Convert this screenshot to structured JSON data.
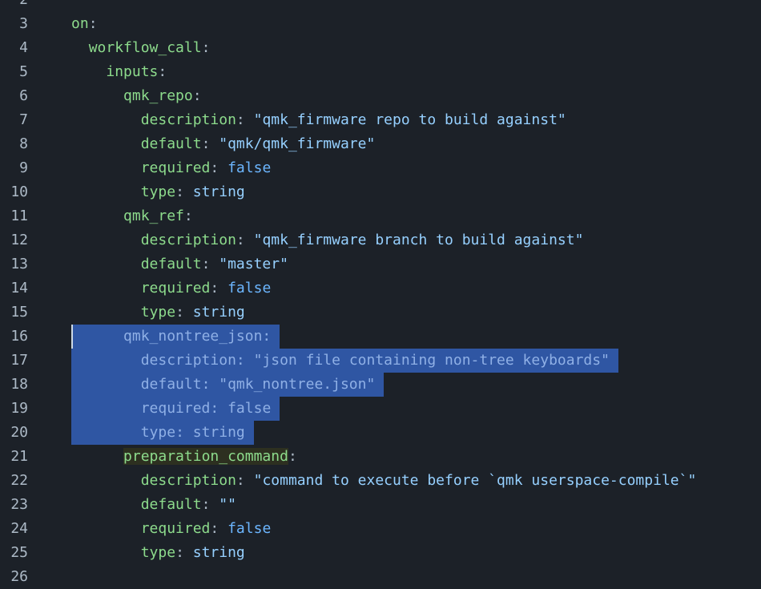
{
  "editor": {
    "theme": {
      "background": "#1c2128",
      "line_number": "#adbac7",
      "key": "#8ddb8c",
      "string": "#96d0ff",
      "boolean": "#6cb6ff",
      "selection": "#2f56a3",
      "bracket_match": "#2d3020"
    },
    "selected_lines": [
      16,
      17,
      18,
      19,
      20
    ],
    "cursor_line": 16,
    "lines": [
      {
        "n": "2",
        "indent": 0,
        "tokens": []
      },
      {
        "n": "3",
        "indent": 0,
        "tokens": [
          {
            "t": "on",
            "c": "key"
          },
          {
            "t": ":",
            "c": "punct"
          }
        ]
      },
      {
        "n": "4",
        "indent": 1,
        "tokens": [
          {
            "t": "workflow_call",
            "c": "key"
          },
          {
            "t": ":",
            "c": "punct"
          }
        ]
      },
      {
        "n": "5",
        "indent": 2,
        "tokens": [
          {
            "t": "inputs",
            "c": "key"
          },
          {
            "t": ":",
            "c": "punct"
          }
        ]
      },
      {
        "n": "6",
        "indent": 3,
        "tokens": [
          {
            "t": "qmk_repo",
            "c": "key"
          },
          {
            "t": ":",
            "c": "punct"
          }
        ]
      },
      {
        "n": "7",
        "indent": 4,
        "tokens": [
          {
            "t": "description",
            "c": "key"
          },
          {
            "t": ": ",
            "c": "punct"
          },
          {
            "t": "\"qmk_firmware repo to build against\"",
            "c": "str"
          }
        ]
      },
      {
        "n": "8",
        "indent": 4,
        "tokens": [
          {
            "t": "default",
            "c": "key"
          },
          {
            "t": ": ",
            "c": "punct"
          },
          {
            "t": "\"qmk/qmk_firmware\"",
            "c": "str"
          }
        ]
      },
      {
        "n": "9",
        "indent": 4,
        "tokens": [
          {
            "t": "required",
            "c": "key"
          },
          {
            "t": ": ",
            "c": "punct"
          },
          {
            "t": "false",
            "c": "bool"
          }
        ]
      },
      {
        "n": "10",
        "indent": 4,
        "tokens": [
          {
            "t": "type",
            "c": "key"
          },
          {
            "t": ": ",
            "c": "punct"
          },
          {
            "t": "string",
            "c": "plain"
          }
        ]
      },
      {
        "n": "11",
        "indent": 3,
        "tokens": [
          {
            "t": "qmk_ref",
            "c": "key"
          },
          {
            "t": ":",
            "c": "punct"
          }
        ]
      },
      {
        "n": "12",
        "indent": 4,
        "tokens": [
          {
            "t": "description",
            "c": "key"
          },
          {
            "t": ": ",
            "c": "punct"
          },
          {
            "t": "\"qmk_firmware branch to build against\"",
            "c": "str"
          }
        ]
      },
      {
        "n": "13",
        "indent": 4,
        "tokens": [
          {
            "t": "default",
            "c": "key"
          },
          {
            "t": ": ",
            "c": "punct"
          },
          {
            "t": "\"master\"",
            "c": "str"
          }
        ]
      },
      {
        "n": "14",
        "indent": 4,
        "tokens": [
          {
            "t": "required",
            "c": "key"
          },
          {
            "t": ": ",
            "c": "punct"
          },
          {
            "t": "false",
            "c": "bool"
          }
        ]
      },
      {
        "n": "15",
        "indent": 4,
        "tokens": [
          {
            "t": "type",
            "c": "key"
          },
          {
            "t": ": ",
            "c": "punct"
          },
          {
            "t": "string",
            "c": "plain"
          }
        ]
      },
      {
        "n": "16",
        "indent": 3,
        "tokens": [
          {
            "t": "qmk_nontree_json",
            "c": "key"
          },
          {
            "t": ":",
            "c": "punct"
          }
        ]
      },
      {
        "n": "17",
        "indent": 4,
        "tokens": [
          {
            "t": "description",
            "c": "key"
          },
          {
            "t": ": ",
            "c": "punct"
          },
          {
            "t": "\"json file containing non-tree keyboards\"",
            "c": "str"
          }
        ]
      },
      {
        "n": "18",
        "indent": 4,
        "tokens": [
          {
            "t": "default",
            "c": "key"
          },
          {
            "t": ": ",
            "c": "punct"
          },
          {
            "t": "\"qmk_nontree.json\"",
            "c": "str"
          }
        ]
      },
      {
        "n": "19",
        "indent": 4,
        "tokens": [
          {
            "t": "required",
            "c": "key"
          },
          {
            "t": ": ",
            "c": "punct"
          },
          {
            "t": "false",
            "c": "bool"
          }
        ]
      },
      {
        "n": "20",
        "indent": 4,
        "tokens": [
          {
            "t": "type",
            "c": "key"
          },
          {
            "t": ": ",
            "c": "punct"
          },
          {
            "t": "string",
            "c": "plain"
          }
        ]
      },
      {
        "n": "21",
        "indent": 3,
        "tokens": [
          {
            "t": "preparation_command",
            "c": "key",
            "match": true
          },
          {
            "t": ":",
            "c": "punct"
          }
        ]
      },
      {
        "n": "22",
        "indent": 4,
        "tokens": [
          {
            "t": "description",
            "c": "key"
          },
          {
            "t": ": ",
            "c": "punct"
          },
          {
            "t": "\"command to execute before `qmk userspace-compile`\"",
            "c": "str"
          }
        ]
      },
      {
        "n": "23",
        "indent": 4,
        "tokens": [
          {
            "t": "default",
            "c": "key"
          },
          {
            "t": ": ",
            "c": "punct"
          },
          {
            "t": "\"\"",
            "c": "str"
          }
        ]
      },
      {
        "n": "24",
        "indent": 4,
        "tokens": [
          {
            "t": "required",
            "c": "key"
          },
          {
            "t": ": ",
            "c": "punct"
          },
          {
            "t": "false",
            "c": "bool"
          }
        ]
      },
      {
        "n": "25",
        "indent": 4,
        "tokens": [
          {
            "t": "type",
            "c": "key"
          },
          {
            "t": ": ",
            "c": "punct"
          },
          {
            "t": "string",
            "c": "plain"
          }
        ]
      },
      {
        "n": "26",
        "indent": 0,
        "tokens": []
      }
    ]
  }
}
